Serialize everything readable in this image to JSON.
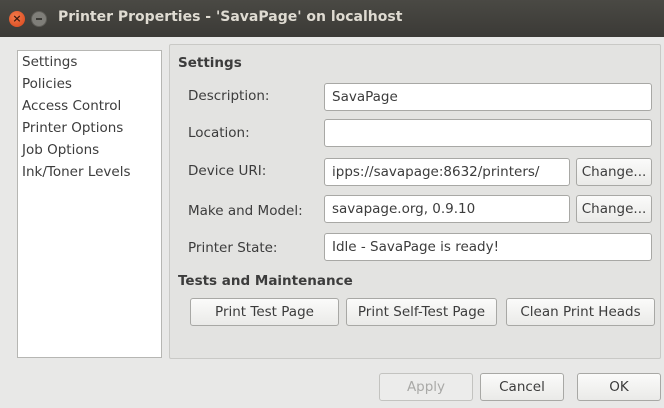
{
  "window": {
    "title": "Printer Properties - 'SavaPage' on localhost"
  },
  "sidebar": {
    "items": [
      {
        "label": "Settings"
      },
      {
        "label": "Policies"
      },
      {
        "label": "Access Control"
      },
      {
        "label": "Printer Options"
      },
      {
        "label": "Job Options"
      },
      {
        "label": "Ink/Toner Levels"
      }
    ]
  },
  "settings": {
    "section_title": "Settings",
    "description_label": "Description:",
    "description_value": "SavaPage",
    "location_label": "Location:",
    "location_value": "",
    "device_uri_label": "Device URI:",
    "device_uri_value": "ipps://savapage:8632/printers/",
    "make_model_label": "Make and Model:",
    "make_model_value": "savapage.org, 0.9.10",
    "printer_state_label": "Printer State:",
    "printer_state_value": "Idle - SavaPage is ready!",
    "change_label": "Change..."
  },
  "maintenance": {
    "section_title": "Tests and Maintenance",
    "print_test_page": "Print Test Page",
    "print_self_test_page": "Print Self-Test Page",
    "clean_print_heads": "Clean Print Heads"
  },
  "footer": {
    "apply": "Apply",
    "cancel": "Cancel",
    "ok": "OK"
  }
}
